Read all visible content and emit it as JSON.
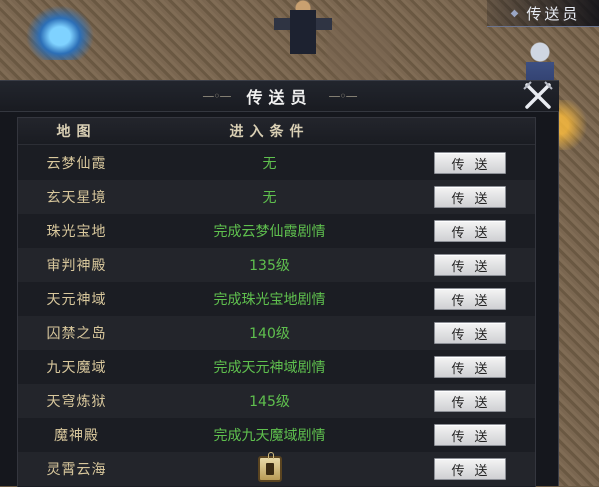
{
  "hud": {
    "npc_name": "传送员"
  },
  "dialog": {
    "title": "传送员",
    "headers": {
      "map": "地图",
      "condition": "进入条件"
    },
    "button_label": "传送",
    "rows": [
      {
        "map": "云梦仙霞",
        "condition": "无"
      },
      {
        "map": "玄天星境",
        "condition": "无"
      },
      {
        "map": "珠光宝地",
        "condition": "完成云梦仙霞剧情"
      },
      {
        "map": "审判神殿",
        "condition": "135级"
      },
      {
        "map": "天元神域",
        "condition": "完成珠光宝地剧情"
      },
      {
        "map": "囚禁之岛",
        "condition": "140级"
      },
      {
        "map": "九天魔域",
        "condition": "完成天元神域剧情"
      },
      {
        "map": "天穹炼狱",
        "condition": "145级"
      },
      {
        "map": "魔神殿",
        "condition": "完成九天魔域剧情"
      },
      {
        "map": "灵霄云海",
        "condition": "",
        "condition_icon": "scroll-item-icon"
      }
    ]
  },
  "colors": {
    "map_name": "#d8c79c",
    "condition": "#5fc04e",
    "header": "#d9cfb4",
    "panel_bg": "#15171d"
  }
}
